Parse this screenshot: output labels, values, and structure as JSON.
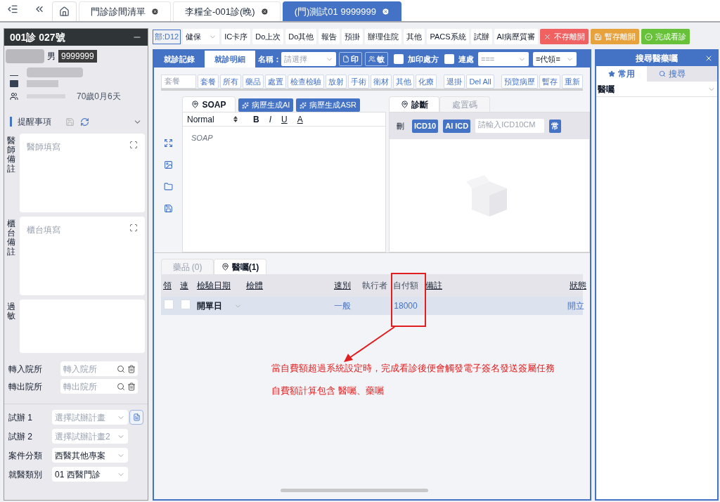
{
  "nav_tabs": [
    {
      "label": "門診診間清單",
      "selected": false
    },
    {
      "label": "李糧全-001診(晚)",
      "selected": false
    },
    {
      "label": "(門)測試01 9999999",
      "selected": true
    }
  ],
  "patient": {
    "title": "001診 027號",
    "sex": "男",
    "chart_no": "9999999",
    "age": "70歲0月6天"
  },
  "reminders": {
    "title": "提醒事項",
    "notes": [
      {
        "label": "醫師備註",
        "placeholder": "醫師填寫"
      },
      {
        "label": "櫃台備註",
        "placeholder": "櫃台填寫"
      },
      {
        "label": "過敏"
      }
    ]
  },
  "referrals": [
    {
      "label": "轉入院所",
      "placeholder": "轉入院所"
    },
    {
      "label": "轉出院所",
      "placeholder": "轉出院所"
    }
  ],
  "selects": [
    {
      "label": "試辦 1",
      "placeholder": "選擇試辦計畫",
      "has_doc": true
    },
    {
      "label": "試辦 2",
      "placeholder": "選擇試辦計畫2",
      "has_doc": false
    },
    {
      "label": "案件分類",
      "value": "西醫其他專案",
      "has_doc": false
    },
    {
      "label": "就醫類別",
      "value": "01 西醫門診",
      "has_doc": false
    }
  ],
  "toolbar": {
    "dept": "部:D12",
    "insurance": "健保",
    "buttons": [
      "IC卡序",
      "Do上次",
      "Do其他",
      "報告",
      "預掛",
      "辦理住院",
      "其他",
      "PACS系統",
      "試辦",
      "AI病歷質審"
    ],
    "actions": [
      {
        "label": "不存離開",
        "kind": "discard"
      },
      {
        "label": "暫存離開",
        "kind": "save"
      },
      {
        "label": "完成看診",
        "kind": "finish"
      }
    ]
  },
  "record_tabs": [
    {
      "label": "就診記錄",
      "selected": false
    },
    {
      "label": "就診明細",
      "selected": true
    }
  ],
  "name_field": {
    "label": "名稱：",
    "placeholder": "請選擇"
  },
  "print_buttons": [
    {
      "label": "印",
      "kind": "print"
    },
    {
      "label": "敏",
      "kind": "allergy"
    }
  ],
  "checkboxes": [
    {
      "label": "加印處方",
      "checked": false
    },
    {
      "label": "連處",
      "checked": false
    }
  ],
  "dropdowns": [
    {
      "placeholder": "==="
    },
    {
      "value": "=代領="
    }
  ],
  "order_search": {
    "placeholder": "套餐"
  },
  "category_buttons": [
    "套餐",
    "所有",
    "藥品",
    "處置",
    "檢查檢驗",
    "放射",
    "手術",
    "衛材",
    "其他",
    "化療"
  ],
  "utility_buttons": [
    "退掛",
    "Del All"
  ],
  "record_buttons": [
    "預覽病歷",
    "暫存",
    "重新"
  ],
  "soap": {
    "tab": "SOAP",
    "ai_buttons": [
      "病歷生成AI",
      "病歷生成ASR"
    ],
    "format": "Normal",
    "format_buttons": [
      "B",
      "I",
      "U",
      "A"
    ],
    "placeholder": "SOAP"
  },
  "diagnosis": {
    "tabs": [
      {
        "label": "診斷",
        "selected": true
      },
      {
        "label": "處置碼",
        "selected": false
      }
    ],
    "delete_label": "刪",
    "buttons": [
      "ICD10",
      "AI ICD"
    ],
    "placeholder": "請輸入ICD10CM",
    "common": "常"
  },
  "order_tabs": [
    {
      "label": "藥品 (0)",
      "selected": false
    },
    {
      "label": "醫囑(1)",
      "selected": true
    }
  ],
  "table": {
    "columns": [
      "領",
      "連",
      "檢驗日期",
      "檢體",
      "速別",
      "執行者",
      "自付額",
      "備註",
      "狀態"
    ],
    "rows": [
      {
        "take": false,
        "continuous": false,
        "date": "開單日",
        "speed": "一般",
        "copay": "18000",
        "status": "開立"
      }
    ]
  },
  "annotation": {
    "lines": [
      "當自費額超過系統設定時，完成看診後便會觸發電子簽名發送簽屬任務",
      "自費額計算包含 醫囑、藥囑"
    ]
  },
  "side_panel": {
    "title": "搜尋醫藥囑",
    "tabs": [
      {
        "label": "常用",
        "selected": true
      },
      {
        "label": "搜尋",
        "selected": false
      }
    ],
    "select": "醫囑"
  }
}
